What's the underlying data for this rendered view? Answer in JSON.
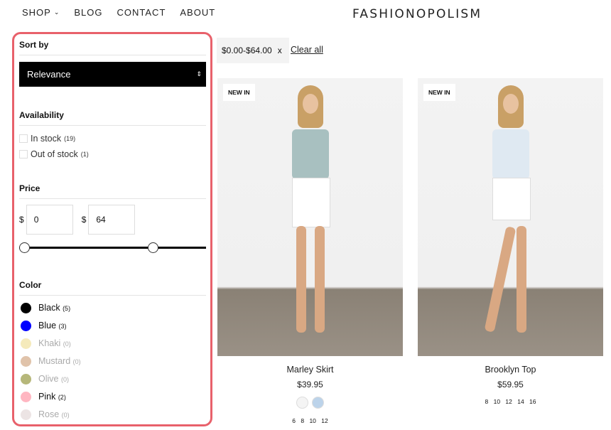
{
  "nav": {
    "items": [
      {
        "label": "SHOP",
        "has_dropdown": true
      },
      {
        "label": "BLOG"
      },
      {
        "label": "CONTACT"
      },
      {
        "label": "ABOUT"
      }
    ]
  },
  "logo": "FASHIONOPOLISM",
  "filters": {
    "sort": {
      "title": "Sort by",
      "value": "Relevance"
    },
    "availability": {
      "title": "Availability",
      "options": [
        {
          "label": "In stock",
          "count": "(19)"
        },
        {
          "label": "Out of stock",
          "count": "(1)"
        }
      ]
    },
    "price": {
      "title": "Price",
      "currency": "$",
      "min": "0",
      "max": "64",
      "range_min": 0,
      "range_max_fraction": 0.73
    },
    "color": {
      "title": "Color",
      "options": [
        {
          "label": "Black",
          "count": "(5)",
          "color": "#000000",
          "available": true
        },
        {
          "label": "Blue",
          "count": "(3)",
          "color": "#0000ff",
          "available": true
        },
        {
          "label": "Khaki",
          "count": "(0)",
          "color": "#f5eabb",
          "available": false
        },
        {
          "label": "Mustard",
          "count": "(0)",
          "color": "#e0c3aa",
          "available": false
        },
        {
          "label": "Olive",
          "count": "(0)",
          "color": "#b6b77a",
          "available": false
        },
        {
          "label": "Pink",
          "count": "(2)",
          "color": "#ffb6c1",
          "available": true
        },
        {
          "label": "Rose",
          "count": "(0)",
          "color": "#ece4e4",
          "available": false
        }
      ]
    }
  },
  "active_filter": {
    "label": "$0.00-$64.00",
    "remove": "x"
  },
  "clear_all": "Clear all",
  "products": [
    {
      "badge": "NEW IN",
      "name": "Marley Skirt",
      "price": "$39.95",
      "swatches": [
        "white",
        "light-blue"
      ],
      "sizes": "6 8 10 12"
    },
    {
      "badge": "NEW IN",
      "name": "Brooklyn Top",
      "price": "$59.95",
      "swatches": [],
      "sizes": "8 10 12 14 16"
    }
  ]
}
